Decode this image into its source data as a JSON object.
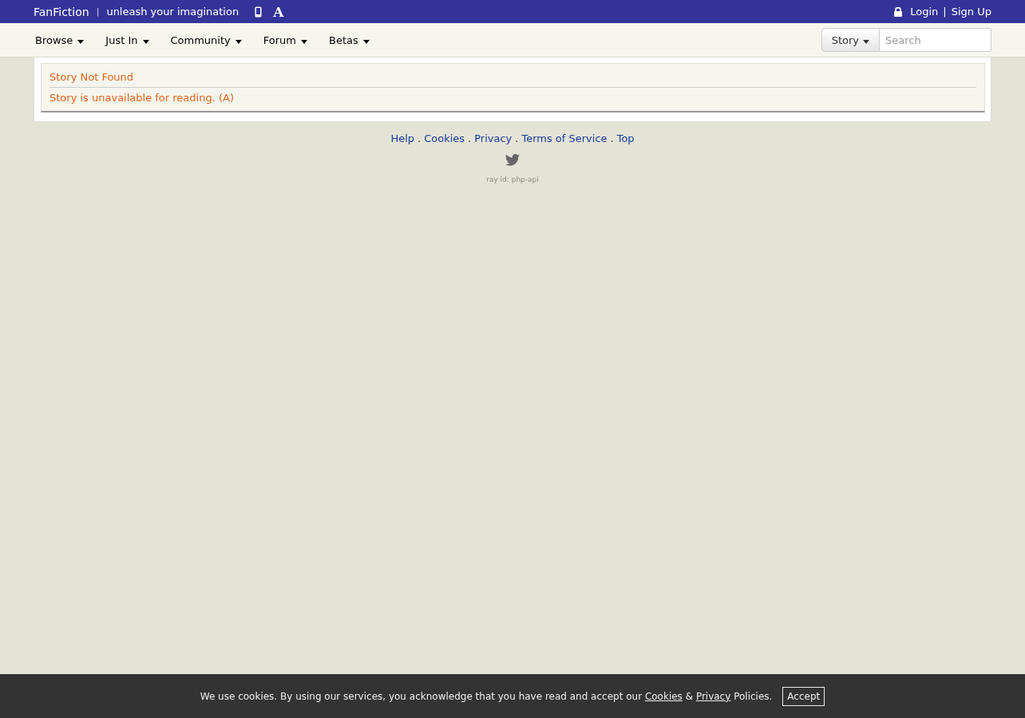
{
  "top_bar": {
    "brand": "FanFiction",
    "separator": "|",
    "tagline": "unleash your imagination",
    "font_icon": "A",
    "login": "Login",
    "divider": "|",
    "signup": "Sign Up"
  },
  "nav": {
    "items": [
      "Browse",
      "Just In",
      "Community",
      "Forum",
      "Betas"
    ]
  },
  "search": {
    "category": "Story",
    "placeholder": "Search"
  },
  "messages": [
    "Story Not Found",
    "Story is unavailable for reading. (A)"
  ],
  "footer": {
    "links": [
      "Help",
      "Cookies",
      "Privacy",
      "Terms of Service",
      "Top"
    ],
    "separator": ".",
    "ray_id": "ray id: php-api"
  },
  "cookie_banner": {
    "parts": [
      {
        "kind": "text",
        "text": "We use cookies. By using our services, you acknowledge that you have read and accept our "
      },
      {
        "kind": "link",
        "text": "Cookies"
      },
      {
        "kind": "text",
        "text": " & "
      },
      {
        "kind": "link",
        "text": "Privacy"
      },
      {
        "kind": "text",
        "text": " Policies."
      }
    ],
    "button": "Accept"
  }
}
